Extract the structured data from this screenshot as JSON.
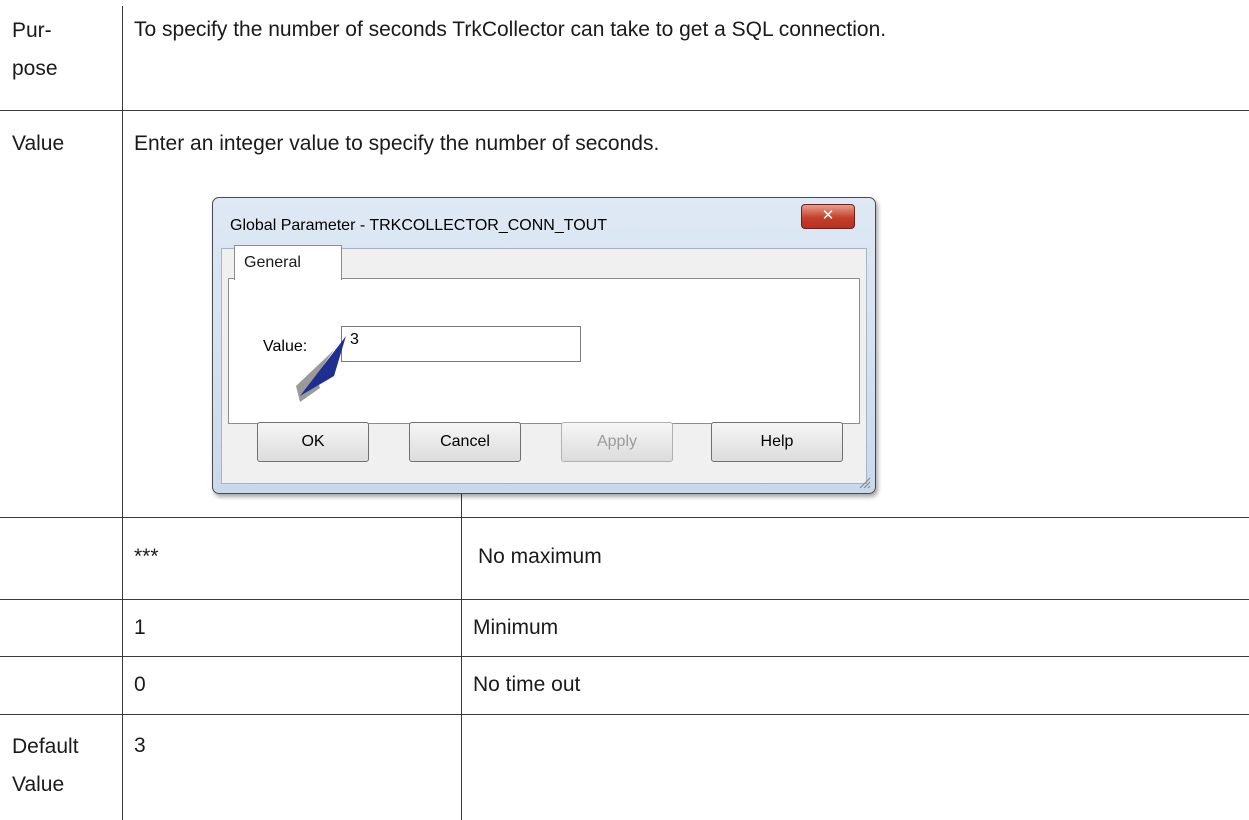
{
  "table": {
    "rows": {
      "purpose": {
        "label": "Pur-\npose",
        "text": "To specify the number of seconds TrkCollector can take to get a SQL connection."
      },
      "value": {
        "label": "Value",
        "text": "Enter an integer value to specify the number of seconds."
      },
      "range": [
        {
          "setting": "***",
          "meaning": "No maximum"
        },
        {
          "setting": "1",
          "meaning": "Minimum"
        },
        {
          "setting": "0",
          "meaning": "No time out"
        }
      ],
      "default": {
        "label": "Default\nValue",
        "value": "3"
      }
    }
  },
  "dialog": {
    "title": "Global Parameter - TRKCOLLECTOR_CONN_TOUT",
    "close_icon": "close-icon",
    "tab": "General",
    "field_label": "Value:",
    "field_value": "3",
    "buttons": {
      "ok": "OK",
      "cancel": "Cancel",
      "apply": "Apply",
      "help": "Help"
    },
    "apply_disabled": true
  },
  "colors": {
    "arrow": "#1f2f8f",
    "close_button": "#c4402b",
    "dialog_frame": "#c9d9ec"
  }
}
